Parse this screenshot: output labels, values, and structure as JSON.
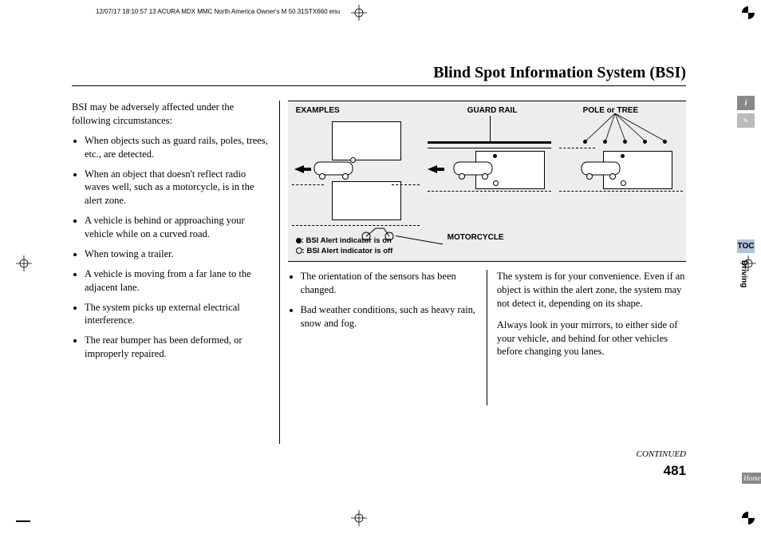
{
  "header": "12/07/17 18:10:57   13 ACURA MDX MMC North America Owner's M 50 31STX660 enu",
  "title": "Blind Spot Information System (BSI)",
  "intro": "BSI may be adversely affected under the following circumstances:",
  "bullets_left": [
    "When objects such as guard rails, poles, trees, etc., are detected.",
    "When an object that doesn't reflect radio waves well, such as a motorcycle, is in the alert zone.",
    "A vehicle is behind or approaching your vehicle while on a curved road.",
    "When towing a trailer.",
    "A vehicle is moving from a far lane to the adjacent lane.",
    "The system picks up external electrical interference.",
    "The rear bumper has been deformed, or improperly repaired."
  ],
  "figure": {
    "examples": "EXAMPLES",
    "guard_rail": "GUARD RAIL",
    "pole_tree": "POLE or TREE",
    "motorcycle": "MOTORCYCLE",
    "legend_on": ": BSI Alert indicator is on",
    "legend_off": ": BSI Alert indicator is off"
  },
  "bullets_mid": [
    "The orientation of the sensors has been changed.",
    "Bad weather conditions, such as heavy rain, snow and fog."
  ],
  "paras_right": [
    "The system is for your convenience. Even if an object is within the alert zone, the system may not detect it, depending on its shape.",
    "Always look in your mirrors, to either side of your vehicle, and behind for other vehicles before changing you lanes."
  ],
  "continued": "CONTINUED",
  "page_num": "481",
  "tabs": {
    "toc": "TOC",
    "section": "Driving",
    "home": "Home"
  }
}
